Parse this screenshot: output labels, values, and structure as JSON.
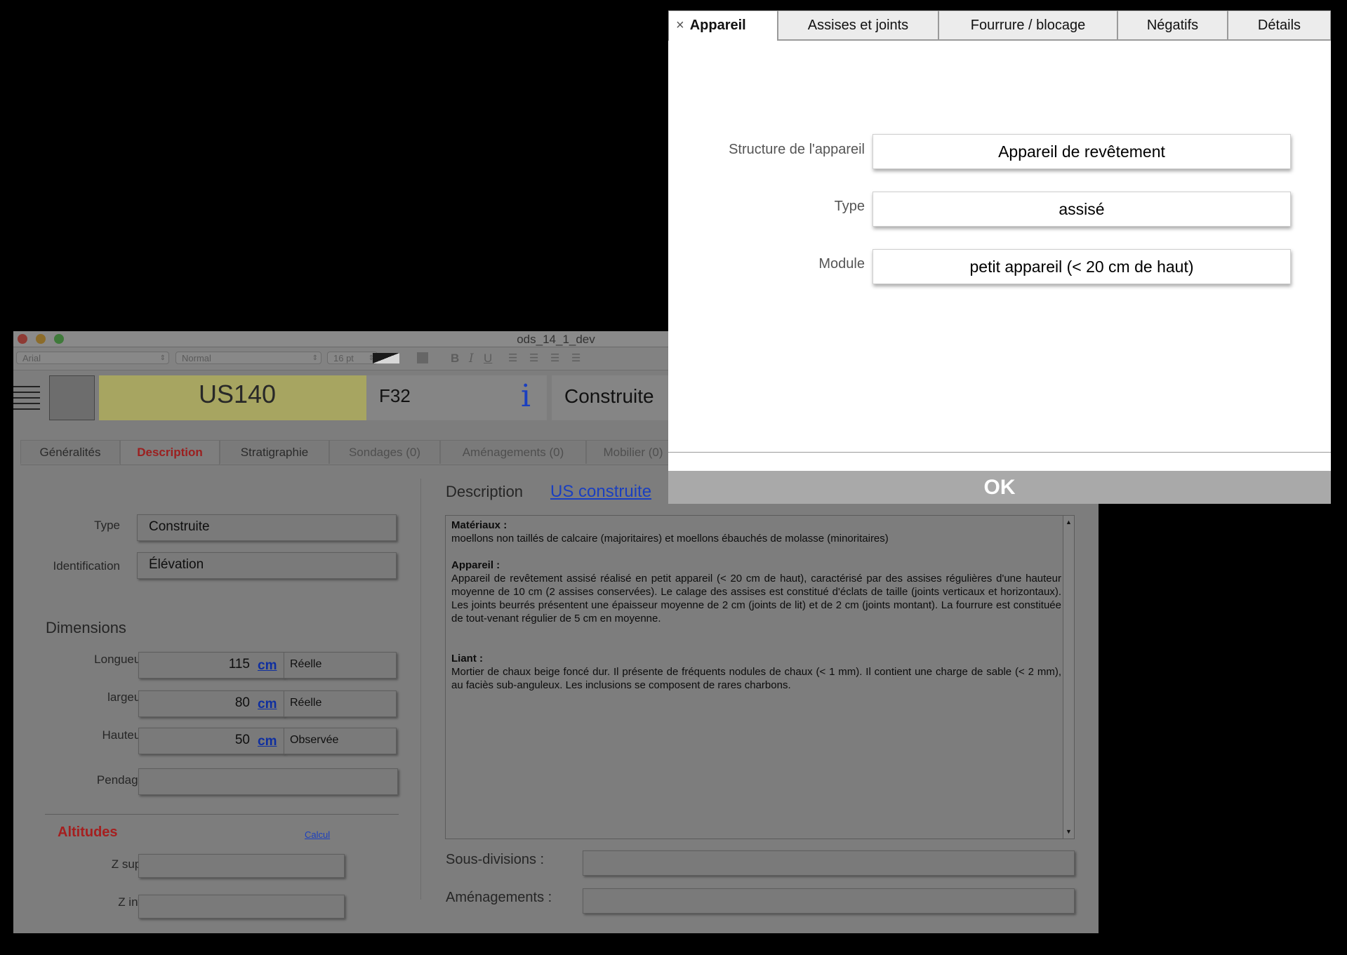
{
  "window": {
    "title": "ods_14_1_dev"
  },
  "toolbar": {
    "font": "Arial",
    "style": "Normal",
    "size": "16 pt",
    "bold": "B",
    "italic": "I",
    "underline": "U"
  },
  "header": {
    "record_id": "US140",
    "fait": "F32",
    "info_glyph": "i",
    "status": "Construite"
  },
  "tabs": [
    {
      "label": "Généralités"
    },
    {
      "label": "Description"
    },
    {
      "label": "Stratigraphie"
    },
    {
      "label": "Sondages (0)"
    },
    {
      "label": "Aménagements (0)"
    },
    {
      "label": "Mobilier (0)"
    }
  ],
  "left": {
    "type_label": "Type",
    "type_value": "Construite",
    "identification_label": "Identification",
    "identification_value": "Élévation",
    "dimensions_heading": "Dimensions",
    "dimensions": [
      {
        "label": "Longueur",
        "value": "115",
        "unit": "cm",
        "qualifier": "Réelle"
      },
      {
        "label": "largeur",
        "value": "80",
        "unit": "cm",
        "qualifier": "Réelle"
      },
      {
        "label": "Hauteur",
        "value": "50",
        "unit": "cm",
        "qualifier": "Observée"
      }
    ],
    "pendage_label": "Pendage",
    "pendage_value": "",
    "altitudes_heading": "Altitudes",
    "calcul_link": "Calcul",
    "zsup_label": "Z sup.",
    "zsup_value": "",
    "zinf_label": "Z inf.",
    "zinf_value": ""
  },
  "right": {
    "description_label": "Description",
    "description_link": "US construite",
    "materiaux_title": "Matériaux :",
    "materiaux_text": "moellons non taillés de calcaire (majoritaires) et moellons ébauchés de molasse (minoritaires)",
    "appareil_title": "Appareil :",
    "appareil_text": "Appareil de revêtement assisé réalisé en petit appareil (< 20 cm de haut), caractérisé par des assises régulières d'une hauteur moyenne de 10 cm (2 assises conservées).  Le calage des assises est constitué d'éclats de taille (joints verticaux et horizontaux). Les joints beurrés présentent une épaisseur moyenne de 2 cm (joints de lit) et de 2 cm (joints montant). La fourrure est constituée de tout-venant régulier de 5 cm en moyenne.",
    "liant_title": "Liant :",
    "liant_text": "Mortier de chaux beige foncé dur. Il présente de fréquents nodules de chaux (< 1 mm). Il contient une charge de sable (< 2 mm), au faciès sub-anguleux. Les inclusions se composent de rares charbons.",
    "sousdivisions_label": "Sous-divisions :",
    "sousdivisions_value": "",
    "amenagements_label": "Aménagements :",
    "amenagements_value": ""
  },
  "modal": {
    "close_glyph": "×",
    "tabs": [
      {
        "label": "Appareil"
      },
      {
        "label": "Assises et joints"
      },
      {
        "label": "Fourrure / blocage"
      },
      {
        "label": "Négatifs"
      },
      {
        "label": "Détails"
      }
    ],
    "fields": [
      {
        "label": "Structure de l'appareil",
        "value": "Appareil de revêtement"
      },
      {
        "label": "Type",
        "value": "assisé"
      },
      {
        "label": "Module",
        "value": "petit appareil (< 20 cm de haut)"
      }
    ],
    "ok_label": "OK"
  },
  "colors": {
    "accent_red": "#b02020",
    "link_blue": "#1a3fc0",
    "record_yellow": "#b4b15a"
  }
}
